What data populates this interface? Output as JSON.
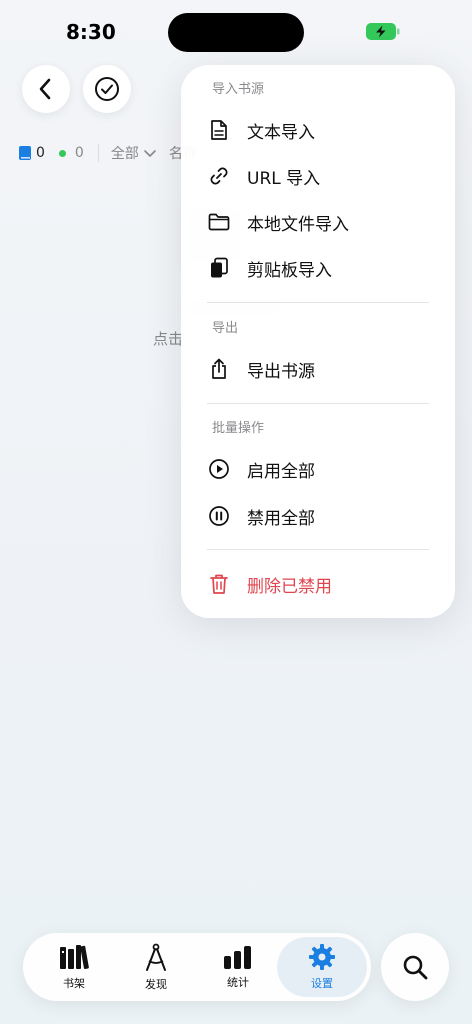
{
  "status_bar": {
    "time": "8:30",
    "battery_icon": "battery-charging-icon",
    "battery_color": "#34c759"
  },
  "toolbar": {
    "back_icon": "chevron-left-icon",
    "select_icon": "checkmark-circle-icon"
  },
  "filter_bar": {
    "book_icon": "book-icon",
    "book_count": "0",
    "enabled_count": "0",
    "enabled_color": "#34c759",
    "filter_label": "全部",
    "sort_label": "名称"
  },
  "empty_state": {
    "hint": "点击"
  },
  "menu": {
    "import_title": "导入书源",
    "import_items": [
      {
        "icon": "document-icon",
        "label": "文本导入"
      },
      {
        "icon": "link-icon",
        "label": "URL 导入"
      },
      {
        "icon": "folder-icon",
        "label": "本地文件导入"
      },
      {
        "icon": "clipboard-icon",
        "label": "剪贴板导入"
      }
    ],
    "export_title": "导出",
    "export_items": [
      {
        "icon": "share-icon",
        "label": "导出书源"
      }
    ],
    "batch_title": "批量操作",
    "batch_items": [
      {
        "icon": "play-circle-icon",
        "label": "启用全部"
      },
      {
        "icon": "pause-circle-icon",
        "label": "禁用全部"
      }
    ],
    "danger_items": [
      {
        "icon": "trash-icon",
        "label": "删除已禁用"
      }
    ],
    "danger_color": "#e0454f"
  },
  "tabbar": {
    "tabs": [
      {
        "icon": "bookshelf-icon",
        "label": "书架"
      },
      {
        "icon": "compass-icon",
        "label": "发现"
      },
      {
        "icon": "bar-chart-icon",
        "label": "统计"
      },
      {
        "icon": "gear-icon",
        "label": "设置"
      }
    ],
    "active_tab": "设置",
    "accent_color": "#1a7fe0",
    "search_icon": "search-icon"
  }
}
